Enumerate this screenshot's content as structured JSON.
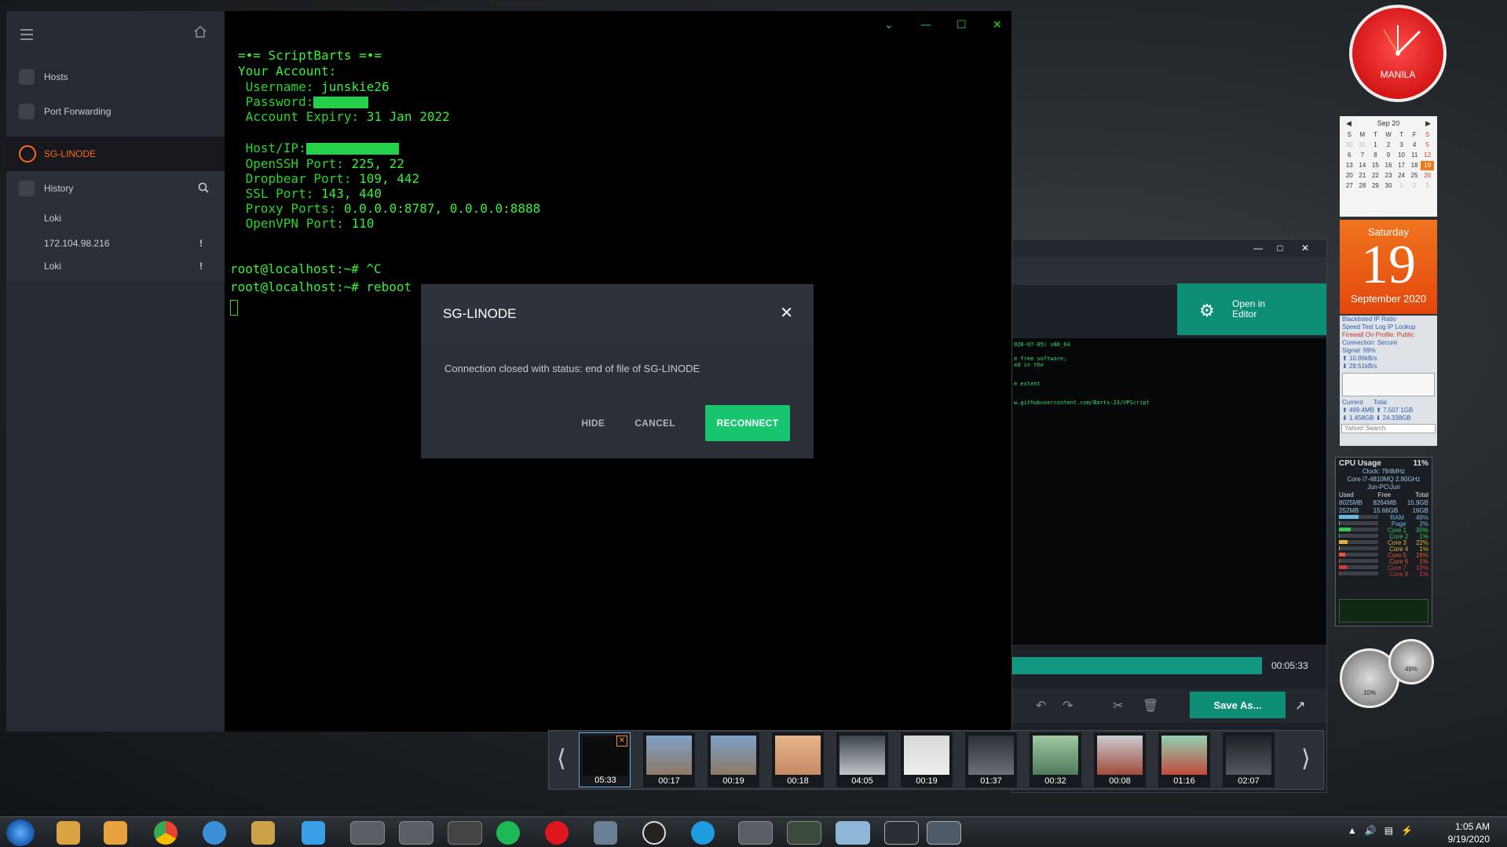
{
  "sidebar": {
    "items": [
      {
        "label": "Hosts",
        "icon": "server-icon"
      },
      {
        "label": "Port Forwarding",
        "icon": "arrow-forward-icon"
      }
    ],
    "active_host": "SG-LINODE",
    "history": {
      "label": "History",
      "entries": [
        {
          "label": "Loki",
          "warn": ""
        },
        {
          "label": "172.104.98.216",
          "warn": "!"
        },
        {
          "label": "Loki",
          "warn": "!"
        }
      ]
    }
  },
  "terminal": {
    "banner": "=•= ScriptBarts =•=",
    "account_header": "Your Account:",
    "username_label": " Username: ",
    "username_value": "junskie26",
    "password_label": " Password:",
    "expiry_label": " Account Expiry: ",
    "expiry_value": "31 Jan 2022",
    "host_label": " Host/IP:",
    "openssh_label": " OpenSSH Port: ",
    "openssh_value": "225, 22",
    "dropbear_label": " Dropbear Port: ",
    "dropbear_value": "109, 442",
    "ssl_label": " SSL Port: ",
    "ssl_value": "143, 440",
    "proxy_label": " Proxy Ports: ",
    "proxy_value": "0.0.0.0:8787, 0.0.0.0:8888",
    "openvpn_label": " OpenVPN Port: ",
    "openvpn_value": "110",
    "prompt1": "root@localhost:~# ^C",
    "prompt2": "root@localhost:~# reboot"
  },
  "dialog": {
    "title": "SG-LINODE",
    "message": "Connection closed with status: end of file of SG-LINODE",
    "hide_label": "HIDE",
    "cancel_label": "CANCEL",
    "reconnect_label": "RECONNECT",
    "close_icon": "close-icon",
    "accent_color": "#18c46e"
  },
  "editor": {
    "open_label_line1": "Open in",
    "open_label_line2": "Editor",
    "code_lines": [
      "020-07-05) x86_64",
      "e free software;",
      "ed in the",
      "e extent",
      "w.githubusercontent.com/Barts-23/VPScript"
    ],
    "time": "00:05:33",
    "save_label": "Save As..."
  },
  "strip": {
    "thumbs": [
      "05:33",
      "00:17",
      "00:19",
      "00:18",
      "04:05",
      "00:19",
      "01:37",
      "00:32",
      "00:08",
      "01:16",
      "02:07"
    ]
  },
  "gadgets": {
    "clock_city": "MANILA",
    "calendar": {
      "month": "Sep 20",
      "weekdays": [
        "S",
        "M",
        "T",
        "W",
        "T",
        "F",
        "S"
      ],
      "today": "19"
    },
    "bigdate": {
      "weekday": "Saturday",
      "day": "19",
      "month": "September 2020"
    },
    "net": {
      "lines": [
        "Blacklisted IP Ratio",
        "Speed Test    Log    IP Lookup",
        "Firewall On    Profile: Public",
        "Connection: Secure",
        "Signal: 99%",
        "10.86kB/s",
        "28.51kB/s"
      ],
      "current_label": "Current",
      "total_label": "Total",
      "cur1": "499.4MB",
      "tot1": "7.507 1GB",
      "cur2": "1.458GB",
      "tot2": "24.338GB",
      "search": "Yahoo! Search"
    },
    "cpu": {
      "title": "CPU Usage",
      "percent": "11%",
      "clock": "Clock: 784MHz",
      "model": "Core i7-4810MQ 2.80GHz",
      "host": "Jun-PC\\Jun",
      "used_label": "Used",
      "free_label": "Free",
      "total_label": "Total",
      "row1": [
        "8025MB",
        "8264MB",
        "15.9GB"
      ],
      "row2": [
        "252MB",
        "15.66GB",
        "16GB"
      ],
      "meters": [
        {
          "name": "RAM",
          "pct": "49%"
        },
        {
          "name": "Page",
          "pct": "2%"
        },
        {
          "name": "Core 1",
          "pct": "30%"
        },
        {
          "name": "Core 2",
          "pct": "1%"
        },
        {
          "name": "Core 3",
          "pct": "22%"
        },
        {
          "name": "Core 4",
          "pct": "1%"
        },
        {
          "name": "Core 5",
          "pct": "16%"
        },
        {
          "name": "Core 6",
          "pct": "1%"
        },
        {
          "name": "Core 7",
          "pct": "19%"
        },
        {
          "name": "Core 8",
          "pct": "1%"
        }
      ]
    },
    "gauge_left": "10%",
    "gauge_right": "49%"
  },
  "taskbar": {
    "time": "1:05 AM",
    "date": "9/19/2020"
  }
}
